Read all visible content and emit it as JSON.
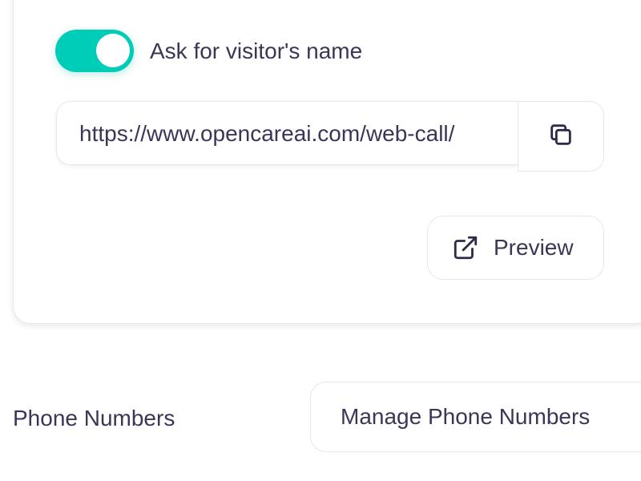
{
  "colors": {
    "accent": "#00cdb8",
    "text": "#3b3656",
    "border": "#e7e6ee"
  },
  "settings": {
    "ask_name_toggle": {
      "label": "Ask for visitor's name",
      "state": "on"
    },
    "web_call_url": {
      "value": "https://www.opencareai.com/web-call/"
    },
    "copy_button": {
      "icon": "copy-icon"
    },
    "preview_button": {
      "label": "Preview",
      "icon": "external-link-icon"
    }
  },
  "phone_numbers": {
    "label": "Phone Numbers",
    "manage_button_label": "Manage Phone Numbers"
  }
}
